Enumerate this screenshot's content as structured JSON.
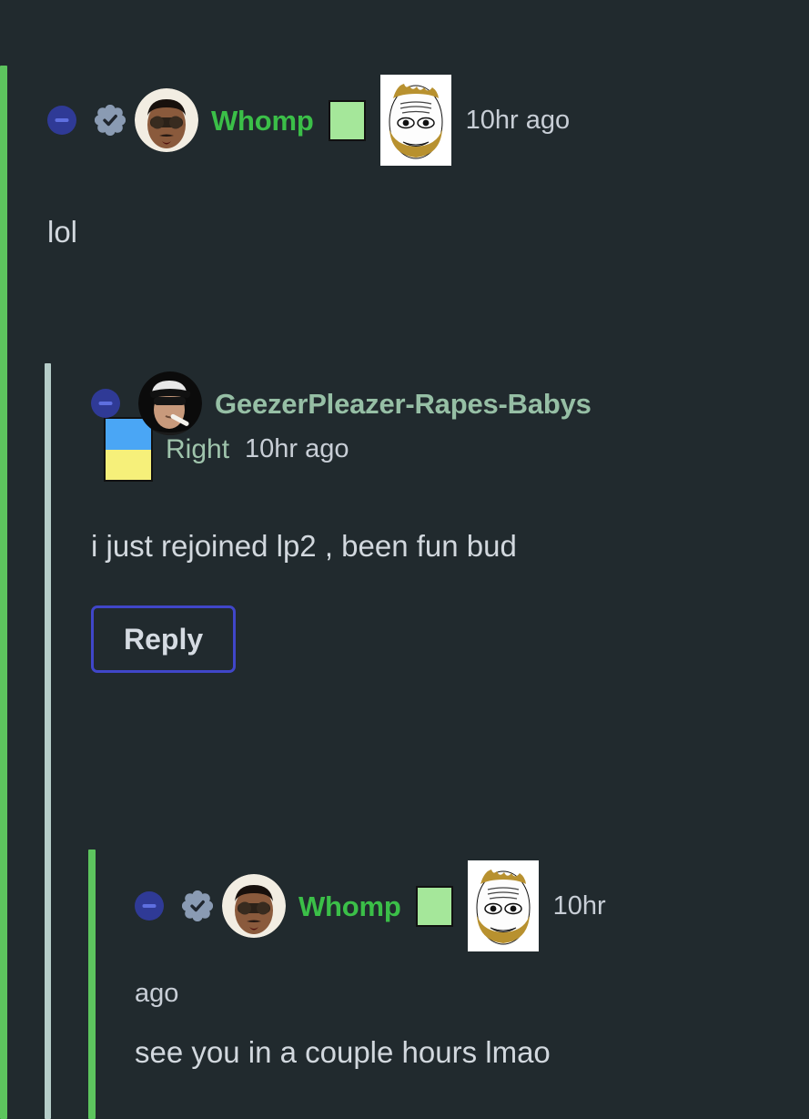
{
  "theme": {
    "background": "#212a2e",
    "body_text": "#d2d8de",
    "thread_line_green": "#5dc45e",
    "thread_line_pale": "#b6cdc9",
    "username_bright_green": "#3bbf48",
    "username_muted_green": "#96bfa5",
    "reply_border": "#4046c9",
    "collapse_circle": "#2f3a96",
    "verified_badge": "#8a9bb3",
    "flair_green": "#a5e79a",
    "flair_ua_blue": "#4aa6f5",
    "flair_ua_yellow": "#f6f07a"
  },
  "comments": [
    {
      "id": "comment-1",
      "depth": 1,
      "collapse_icon": "minus-circle-icon",
      "verified_icon": "verified-badge-icon",
      "avatar_icon": "avatar-whomp",
      "username": "Whomp",
      "username_style": "bright",
      "flair": "green-square-flair",
      "emoji": "soyjak-beard-emoji",
      "timestamp": "10hr ago",
      "body": "lol",
      "has_reply_button": false
    },
    {
      "id": "comment-2",
      "depth": 2,
      "collapse_icon": "minus-circle-icon",
      "avatar_icon": "avatar-geezerpleazer",
      "username": "GeezerPleazer-Rapes-Babys",
      "username_style": "muted",
      "flair": "ukraine-flag-flair",
      "side_label": "Right",
      "timestamp": "10hr ago",
      "body": "i just rejoined lp2 , been fun bud",
      "has_reply_button": true,
      "reply_label": "Reply"
    },
    {
      "id": "comment-3",
      "depth": 3,
      "collapse_icon": "minus-circle-icon",
      "verified_icon": "verified-badge-icon",
      "avatar_icon": "avatar-whomp",
      "username": "Whomp",
      "username_style": "bright",
      "flair": "green-square-flair",
      "emoji": "soyjak-beard-emoji",
      "timestamp": "10hr",
      "timestamp_wrapped": "ago",
      "body": "see you in a couple hours lmao",
      "has_reply_button": false
    }
  ]
}
